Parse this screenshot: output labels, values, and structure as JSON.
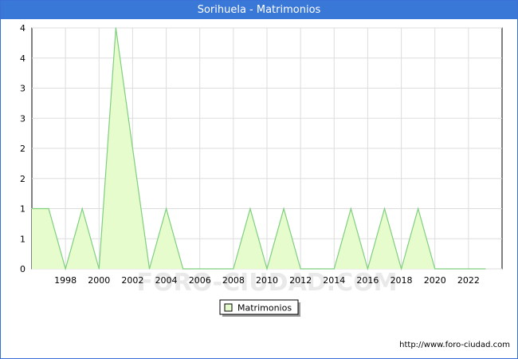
{
  "title": "Sorihuela - Matrimonios",
  "footer": "http://www.foro-ciudad.com",
  "watermark": "FORO-CIUDAD.COM",
  "colors": {
    "title_bg": "#3a78d8",
    "area_fill": "#e6fccd",
    "area_line": "#7fcf7f",
    "grid": "#dddddd"
  },
  "chart_data": {
    "type": "area",
    "title": "Sorihuela - Matrimonios",
    "legend": {
      "position": "bottom-center",
      "entries": [
        "Matrimonios"
      ]
    },
    "grid": true,
    "xlim": [
      1996,
      2024
    ],
    "ylim": [
      0,
      4
    ],
    "x_ticks": [
      1998,
      2000,
      2002,
      2004,
      2006,
      2008,
      2010,
      2012,
      2014,
      2016,
      2018,
      2020,
      2022
    ],
    "y_ticks": [
      {
        "value": 0,
        "label": "0"
      },
      {
        "value": 0.5,
        "label": "1"
      },
      {
        "value": 1,
        "label": "1"
      },
      {
        "value": 1.5,
        "label": "2"
      },
      {
        "value": 2,
        "label": "2"
      },
      {
        "value": 2.5,
        "label": "3"
      },
      {
        "value": 3,
        "label": "3"
      },
      {
        "value": 3.5,
        "label": "4"
      },
      {
        "value": 4,
        "label": "4"
      }
    ],
    "series": [
      {
        "name": "Matrimonios",
        "x": [
          1996,
          1997,
          1998,
          1999,
          2000,
          2001,
          2002,
          2003,
          2004,
          2005,
          2006,
          2007,
          2008,
          2009,
          2010,
          2011,
          2012,
          2013,
          2014,
          2015,
          2016,
          2017,
          2018,
          2019,
          2020,
          2021,
          2022,
          2023
        ],
        "values": [
          1,
          1,
          0,
          1,
          0,
          4,
          2,
          0,
          1,
          0,
          0,
          0,
          0,
          1,
          0,
          1,
          0,
          0,
          0,
          1,
          0,
          1,
          0,
          1,
          0,
          0,
          0,
          0
        ]
      }
    ]
  }
}
